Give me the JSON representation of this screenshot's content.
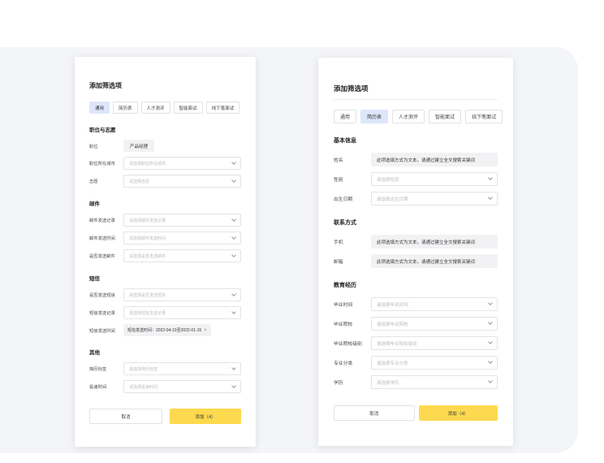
{
  "left": {
    "title": "添加筛选项",
    "tabs": [
      "通用",
      "简历表",
      "人才测评",
      "智能面试",
      "线下笔面试"
    ],
    "sections": {
      "position": "职位与志愿",
      "mail": "邮件",
      "sms": "短信",
      "other": "其他"
    },
    "position_row": {
      "label": "职位",
      "tag": "产品经理"
    },
    "city_row": {
      "label": "职位所在城市",
      "placeholder": "请选择职位所在城市"
    },
    "wish_row": {
      "label": "志愿",
      "placeholder": "请选择志愿"
    },
    "mail_record": {
      "label": "邮件发送记录",
      "placeholder": "请选择邮件发送记录"
    },
    "mail_time": {
      "label": "邮件发送时间",
      "placeholder": "请选择邮件发送时间"
    },
    "mail_sent": {
      "label": "是否发送邮件",
      "placeholder": "请选择是否发送邮件"
    },
    "sms_sent": {
      "label": "是否发送短信",
      "placeholder": "请选择是否发送短信"
    },
    "sms_record": {
      "label": "短信发送记录",
      "placeholder": "请选择短信发送记录"
    },
    "sms_time": {
      "label": "短信发送时间",
      "value": "短信发送时间：2022-04-10至2022-01-15",
      "close": "×"
    },
    "resume_tag": {
      "label": "简历标签",
      "placeholder": "请选择简历标签"
    },
    "submit_time": {
      "label": "投递时间",
      "placeholder": "请选择投递时间"
    },
    "cancel": "取消",
    "add": "添加（4）"
  },
  "right": {
    "title": "添加筛选项",
    "tabs": [
      "通用",
      "简历表",
      "人才测评",
      "智能面试",
      "线下笔面试"
    ],
    "sections": {
      "basic": "基本信息",
      "contact": "联系方式",
      "edu": "教育经历"
    },
    "name_row": {
      "label": "姓名",
      "value": "此项选填方式为文本，请通过建立全文搜索关键词"
    },
    "gender_row": {
      "label": "性别",
      "placeholder": "请选择性别"
    },
    "birth_row": {
      "label": "出生日期",
      "placeholder": "请选择出生日期"
    },
    "phone_row": {
      "label": "手机",
      "value": "此项选填方式为文本，请通过建立全文搜索关键词"
    },
    "email_row": {
      "label": "邮箱",
      "value": "此项选填方式为文本，请通过建立全文搜索关键词"
    },
    "grad_time": {
      "label": "毕业时间",
      "placeholder": "请选择毕业时间"
    },
    "grad_school": {
      "label": "毕业院校",
      "placeholder": "请选择毕业院校"
    },
    "school_level": {
      "label": "毕业院校级别",
      "placeholder": "请选择毕业院校级别"
    },
    "major": {
      "label": "专业分类",
      "placeholder": "请选择专业分类"
    },
    "degree": {
      "label": "学历",
      "placeholder": "请选择学历"
    },
    "cancel": "取消",
    "add": "添加（4）"
  }
}
